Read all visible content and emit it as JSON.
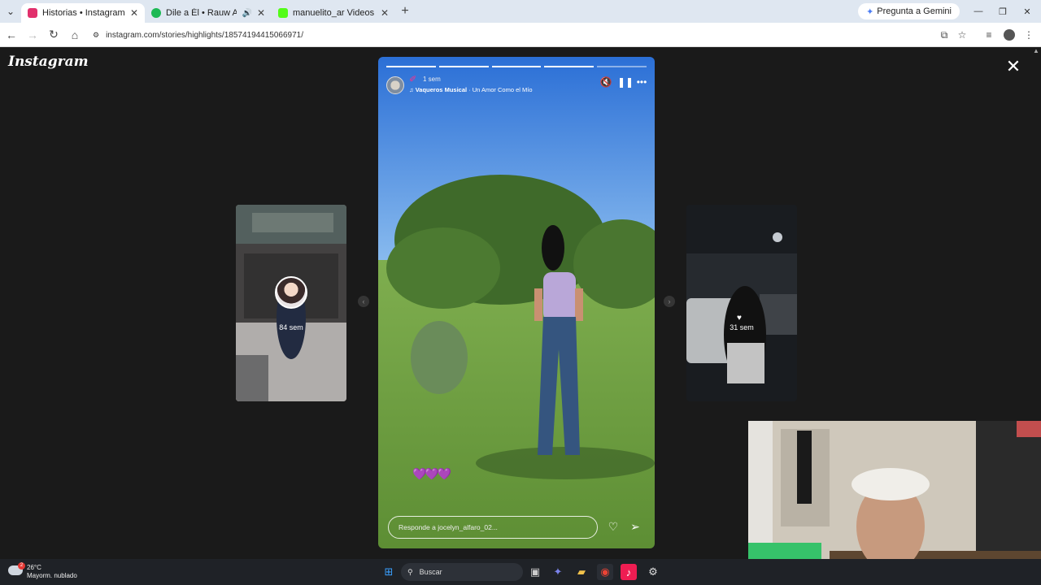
{
  "browser": {
    "tabs": [
      {
        "title": "Historias • Instagram",
        "active": true,
        "favicon_color": "#e1306c"
      },
      {
        "title": "Dile a Él • Rauw Alejandro",
        "active": false,
        "favicon_color": "#1db954"
      },
      {
        "title": "manuelito_ar Videos - Watch O",
        "active": false,
        "favicon_color": "#53fc18"
      }
    ],
    "gemini_label": "Pregunta a Gemini",
    "url": "instagram.com/stories/highlights/18574194415066971/"
  },
  "page": {
    "logo": "Instagram",
    "close_icon": "close-icon",
    "prev_story": {
      "time": "84 sem"
    },
    "next_story": {
      "time": "31 sem"
    },
    "story": {
      "time": "1 sem",
      "music_artist": "Vaqueros Musical",
      "music_sep": " · ",
      "music_song": "Un Amor Como el Mío",
      "reply_placeholder": "Responde a jocelyn_alfaro_02...",
      "progress_segments": 5,
      "progress_current": 5,
      "hearts": "💜💜💜"
    }
  },
  "taskbar": {
    "weather_temp": "26°C",
    "weather_desc": "Mayorm. nublado",
    "weather_badge": "2",
    "search_placeholder": "Buscar"
  }
}
